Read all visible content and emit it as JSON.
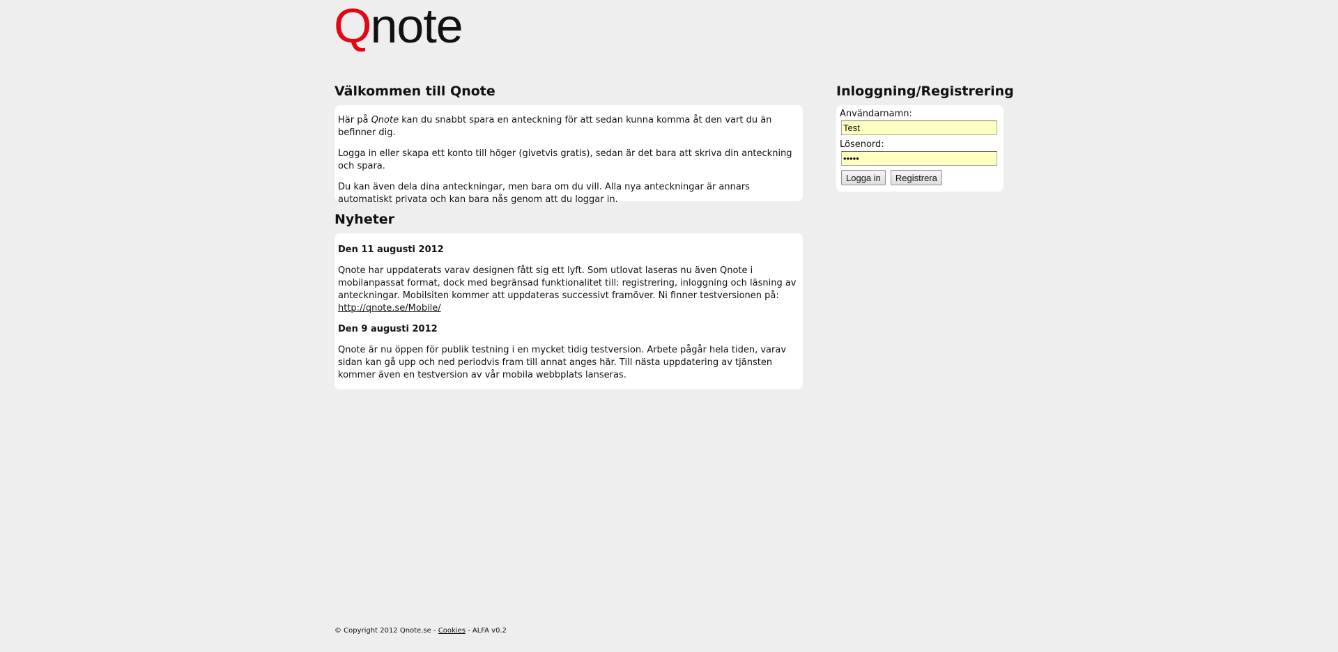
{
  "logo": {
    "q": "Q",
    "rest": "note"
  },
  "welcome": {
    "title": "Välkommen till Qnote",
    "p1_before": "Här på ",
    "p1_brand": "Qnote",
    "p1_after": " kan du snabbt spara en anteckning för att sedan kunna komma åt den vart du än befinner dig.",
    "p2": "Logga in eller skapa ett konto till höger (givetvis gratis), sedan är det bara att skriva din anteckning och spara.",
    "p3": "Du kan även dela dina anteckningar, men bara om du vill. Alla nya anteckningar är annars automatiskt privata och kan bara nås genom att du loggar in."
  },
  "news": {
    "title": "Nyheter",
    "items": [
      {
        "date": "Den 11 augusti 2012",
        "text": "Qnote har uppdaterats varav designen fått sig ett lyft. Som utlovat laseras nu även Qnote i mobilanpassat format, dock med begränsad funktionalitet till: registrering, inloggning och läsning av anteckningar. Mobilsiten kommer att uppdateras successivt framöver. Ni finner testversionen på: ",
        "link": "http://qnote.se/Mobile/"
      },
      {
        "date": "Den 9 augusti 2012",
        "text": "Qnote är nu öppen för publik testning i en mycket tidig testversion. Arbete pågår hela tiden, varav sidan kan gå upp och ned periodvis fram till annat anges här. Till nästa uppdatering av tjänsten kommer även en testversion av vår mobila webbplats lanseras."
      }
    ]
  },
  "login": {
    "title": "Inloggning/Registrering",
    "username_label": "Användarnamn:",
    "username_value": "Test",
    "password_label": "Lösenord:",
    "password_value": "12345",
    "login_button": "Logga in",
    "register_button": "Registrera"
  },
  "footer": {
    "copyright": "© Copyright 2012 Qnote.se - ",
    "cookies_link": "Cookies",
    "version": " - ALFA v0.2"
  }
}
